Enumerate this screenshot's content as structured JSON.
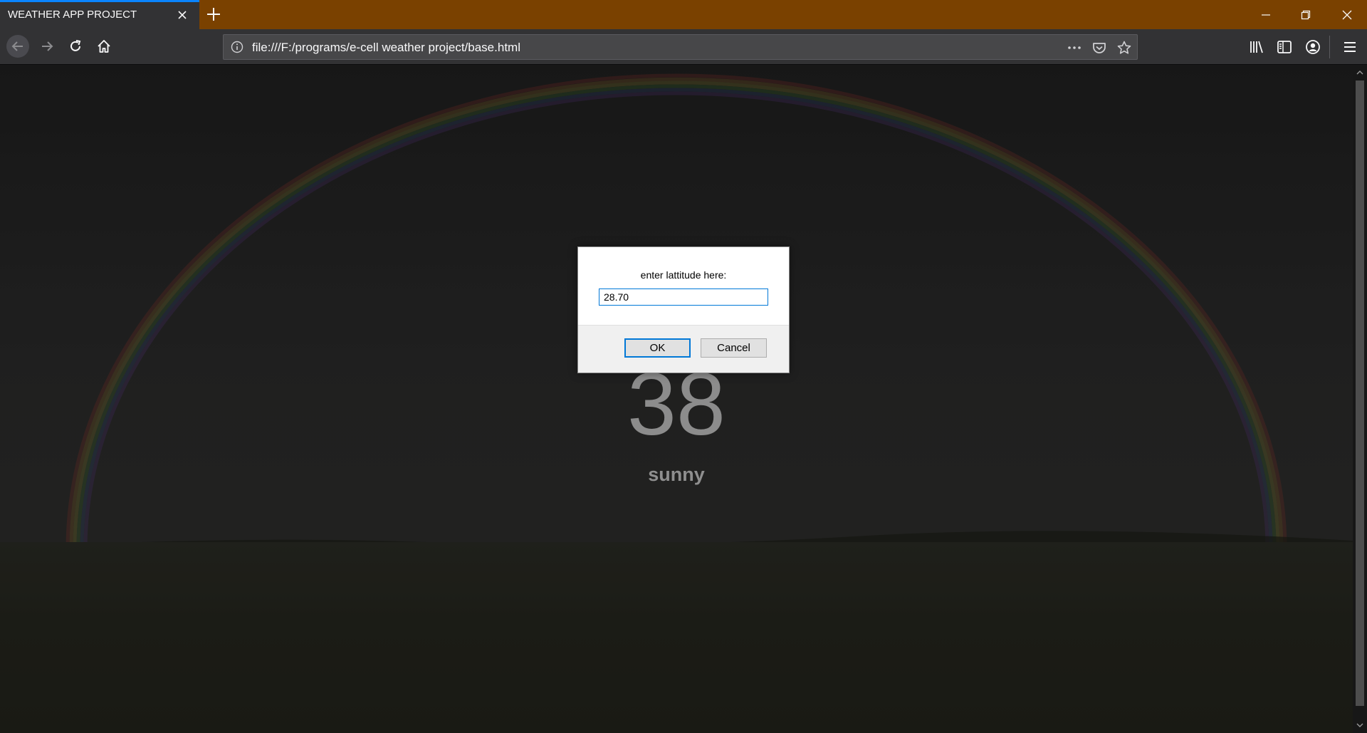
{
  "browser": {
    "tab_title": "WEATHER APP PROJECT",
    "url": "file:///F:/programs/e-cell weather project/base.html",
    "accent_color": "#0a84ff",
    "titlebar_color": "#7a4100"
  },
  "icons": {
    "tab_close": "close-icon",
    "new_tab": "plus-icon",
    "back": "arrow-left-icon",
    "forward": "arrow-right-icon",
    "reload": "reload-icon",
    "home": "home-icon",
    "site_info": "info-icon",
    "page_actions": "ellipsis-icon",
    "pocket": "pocket-icon",
    "bookmark": "star-icon",
    "library": "library-icon",
    "sidebar": "sidebar-icon",
    "account": "account-icon",
    "menu": "hamburger-menu-icon"
  },
  "page": {
    "temperature": "38",
    "condition": "sunny"
  },
  "dialog": {
    "message": "enter lattitude here:",
    "input_value": "28.70",
    "ok_label": "OK",
    "cancel_label": "Cancel"
  }
}
